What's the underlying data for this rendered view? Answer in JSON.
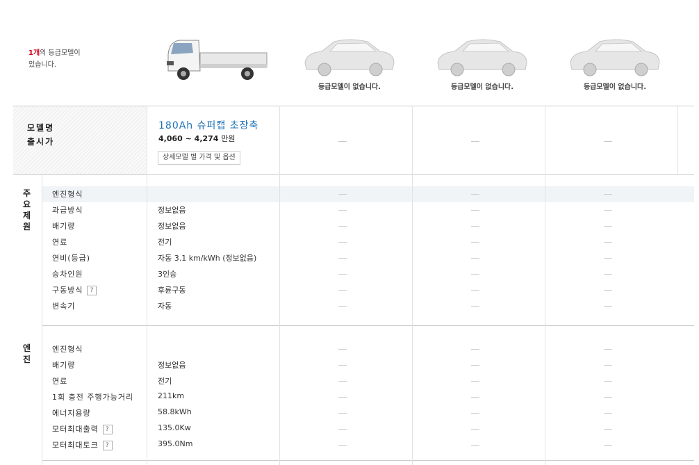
{
  "header": {
    "count_number": "1개",
    "count_suffix": "의 등급모델이",
    "count_line2": "있습니다.",
    "no_model_caption": "등급모델이 없습니다."
  },
  "model": {
    "label_name": "모델명",
    "label_price": "출시가",
    "name": "180Ah 슈퍼캡 초장축",
    "price": "4,060 ~ 4,274",
    "price_unit": "만원",
    "detail_button": "상세모델 별 가격 및 옵션"
  },
  "sections": [
    {
      "title": "주요제원",
      "rows": [
        {
          "label": "엔진형식",
          "value": "",
          "help": false
        },
        {
          "label": "과급방식",
          "value": "정보없음",
          "help": false
        },
        {
          "label": "배기량",
          "value": "정보없음",
          "help": false
        },
        {
          "label": "연료",
          "value": "전기",
          "help": false
        },
        {
          "label": "연비(등급)",
          "value": "자동 3.1 km/kWh (정보없음)",
          "help": false
        },
        {
          "label": "승차인원",
          "value": "3인승",
          "help": false
        },
        {
          "label": "구동방식",
          "value": "후륜구동",
          "help": true
        },
        {
          "label": "변속기",
          "value": "자동",
          "help": false
        }
      ]
    },
    {
      "title": "엔진",
      "rows": [
        {
          "label": "엔진형식",
          "value": "",
          "help": false
        },
        {
          "label": "배기량",
          "value": "정보없음",
          "help": false
        },
        {
          "label": "연료",
          "value": "전기",
          "help": false
        },
        {
          "label": "1회 충전 주행가능거리",
          "value": "211km",
          "help": false
        },
        {
          "label": "에너지용량",
          "value": "58.8kWh",
          "help": false
        },
        {
          "label": "모터최대출력",
          "value": "135.0Kw",
          "help": true
        },
        {
          "label": "모터최대토크",
          "value": "395.0Nm",
          "help": true
        }
      ]
    }
  ],
  "help_symbol": "?",
  "colors": {
    "model_name": "#1a6fb5",
    "count_red": "#d0021b",
    "highlight_row": "#f1f4f7"
  }
}
